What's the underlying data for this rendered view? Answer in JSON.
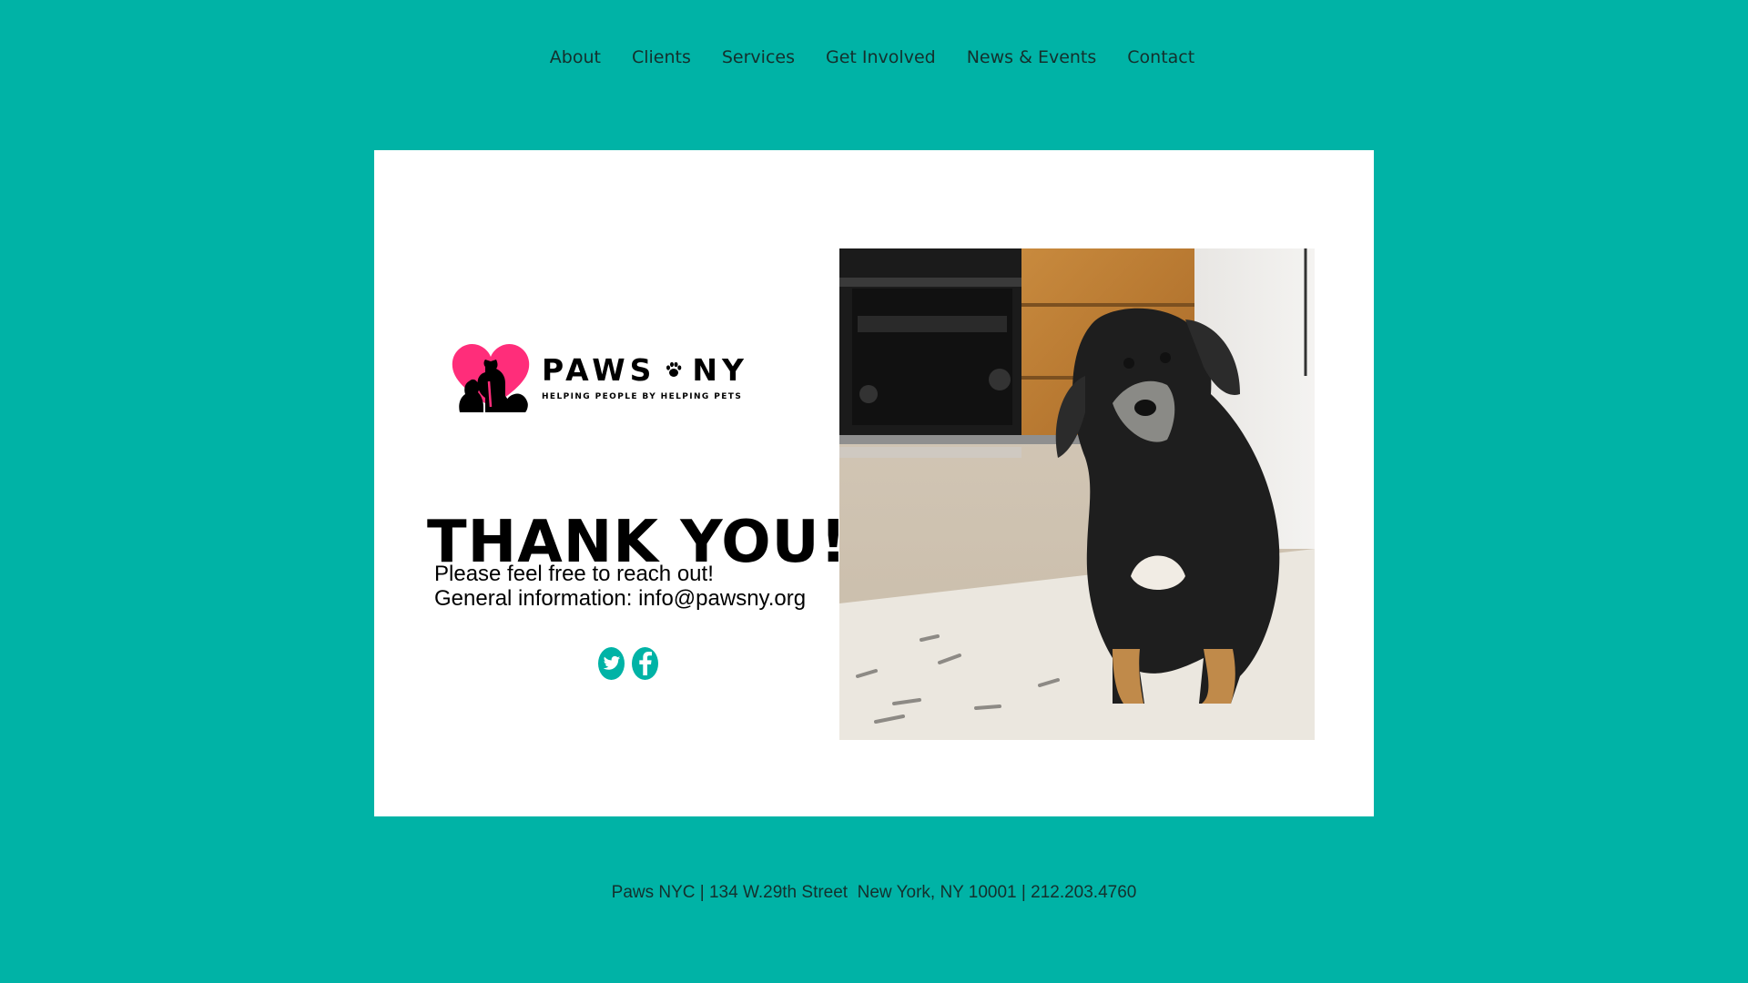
{
  "nav": {
    "items": [
      {
        "label": "About"
      },
      {
        "label": "Clients"
      },
      {
        "label": "Services"
      },
      {
        "label": "Get Involved"
      },
      {
        "label": "News & Events"
      },
      {
        "label": "Contact"
      }
    ]
  },
  "logo": {
    "name_left": "PAWS",
    "name_right": "NY",
    "tagline": "HELPING PEOPLE BY HELPING PETS",
    "icon": "heart-dog-cat-logo",
    "paw_icon": "paw-icon"
  },
  "main": {
    "heading": "THANK YOU!",
    "line1": "Please feel free to reach out!",
    "line2": "General information: info@pawsny.org"
  },
  "social": [
    {
      "icon": "twitter-icon"
    },
    {
      "icon": "facebook-icon"
    }
  ],
  "footer": {
    "text": "Paws NYC | 134 W.29th Street  New York, NY 10001 | 212.203.4760"
  },
  "colors": {
    "background": "#00b3a6",
    "card": "#ffffff",
    "logo_heart": "#ff2d7a",
    "social": "#00b3a6"
  }
}
